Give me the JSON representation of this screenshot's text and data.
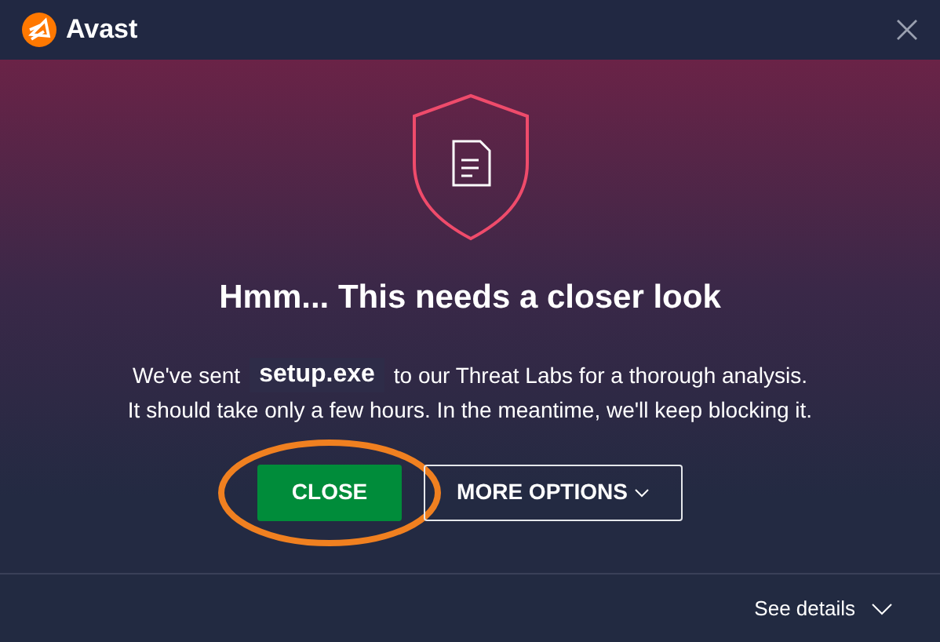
{
  "window": {
    "title": "Avast"
  },
  "dialog": {
    "heading": "Hmm... This needs a closer look",
    "message_start": "We've sent",
    "file_name": "setup.exe",
    "message_end": "to our Threat Labs for a thorough analysis.",
    "message_line_2": "It should take only a few hours. In the meantime, we'll keep blocking it."
  },
  "buttons": [
    {
      "label": "CLOSE",
      "kind": "primary",
      "highlighted": true
    },
    {
      "label": "MORE OPTIONS",
      "kind": "dropdown",
      "highlighted": false
    }
  ],
  "footer": {
    "link": "See details"
  }
}
